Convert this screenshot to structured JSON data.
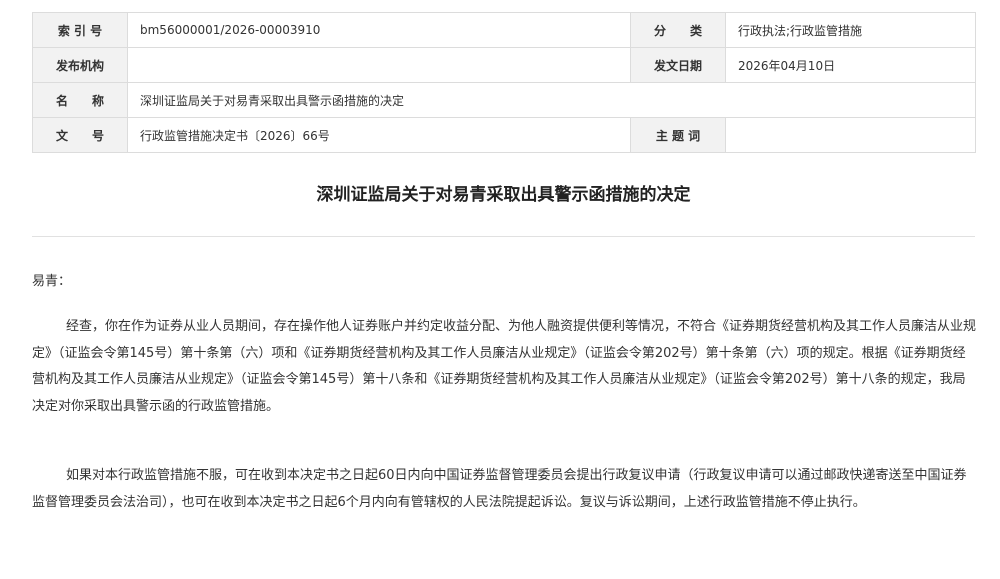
{
  "meta": {
    "index_label": "索 引 号",
    "index_value": "bm56000001/2026-00003910",
    "category_label": "分　　类",
    "category_value": "行政执法;行政监管措施",
    "issuer_label": "发布机构",
    "issuer_value": "",
    "date_label": "发文日期",
    "date_value": "2026年04月10日",
    "name_label": "名　　称",
    "name_value": "深圳证监局关于对易青采取出具警示函措施的决定",
    "docno_label": "文　　号",
    "docno_value": "行政监管措施决定书〔2026〕66号",
    "topic_label": "主 题 词",
    "topic_value": ""
  },
  "document": {
    "title": "深圳证监局关于对易青采取出具警示函措施的决定",
    "salutation": "易青：",
    "paragraphs": [
      "经查，你在作为证券从业人员期间，存在操作他人证券账户并约定收益分配、为他人融资提供便利等情况，不符合《证券期货经营机构及其工作人员廉洁从业规定》（证监会令第145号）第十条第（六）项和《证券期货经营机构及其工作人员廉洁从业规定》（证监会令第202号）第十条第（六）项的规定。根据《证券期货经营机构及其工作人员廉洁从业规定》（证监会令第145号）第十八条和《证券期货经营机构及其工作人员廉洁从业规定》（证监会令第202号）第十八条的规定，我局决定对你采取出具警示函的行政监管措施。",
      "如果对本行政监管措施不服，可在收到本决定书之日起60日内向中国证券监督管理委员会提出行政复议申请（行政复议申请可以通过邮政快递寄送至中国证券监督管理委员会法治司），也可在收到本决定书之日起6个月内向有管辖权的人民法院提起诉讼。复议与诉讼期间，上述行政监管措施不停止执行。"
    ]
  }
}
